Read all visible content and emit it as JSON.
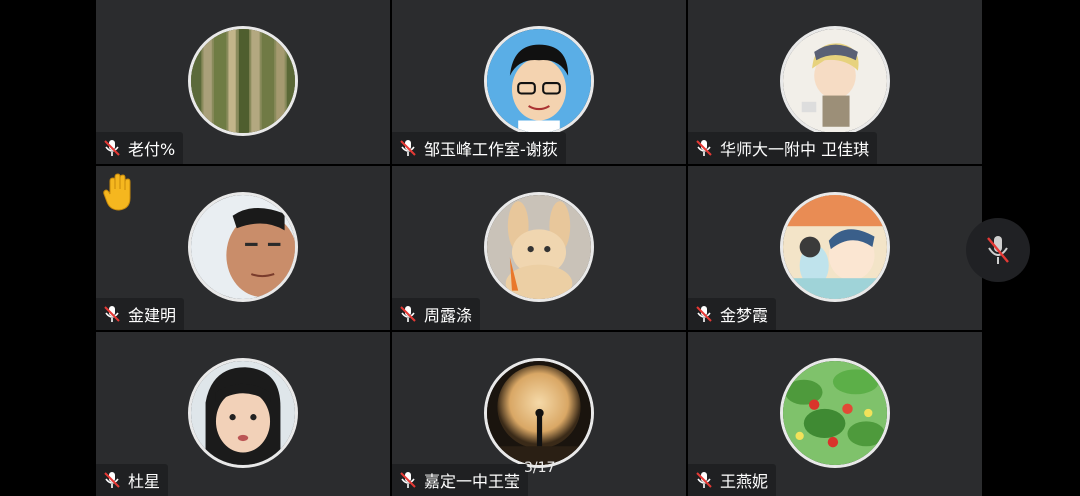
{
  "participants": [
    {
      "name": "老付%",
      "avatar": "bamboo-photo",
      "mic": "muted"
    },
    {
      "name": "邹玉峰工作室-谢荻",
      "avatar": "cartoon-man-glasses",
      "mic": "muted"
    },
    {
      "name": "华师大一附中 卫佳琪",
      "avatar": "anime-character",
      "mic": "muted"
    },
    {
      "name": "金建明",
      "avatar": "man-portrait",
      "mic": "muted",
      "hand_raised": true
    },
    {
      "name": "周露涤",
      "avatar": "bunny-cat-toy",
      "mic": "muted"
    },
    {
      "name": "金梦霞",
      "avatar": "illustrated-children",
      "mic": "muted"
    },
    {
      "name": "杜星",
      "avatar": "girl-portrait",
      "mic": "muted"
    },
    {
      "name": "嘉定一中王莹",
      "avatar": "moon-silhouette",
      "mic": "muted"
    },
    {
      "name": "王燕妮",
      "avatar": "strawberry-plant-art",
      "mic": "muted"
    }
  ],
  "pagination": {
    "label": "3/17"
  },
  "controls": {
    "mic_state": "muted"
  },
  "colors": {
    "tile_bg": "#2b2c2e",
    "tag_bg": "#1f2022",
    "mic_muted": "#e53935",
    "hand": "#f5b71f"
  }
}
